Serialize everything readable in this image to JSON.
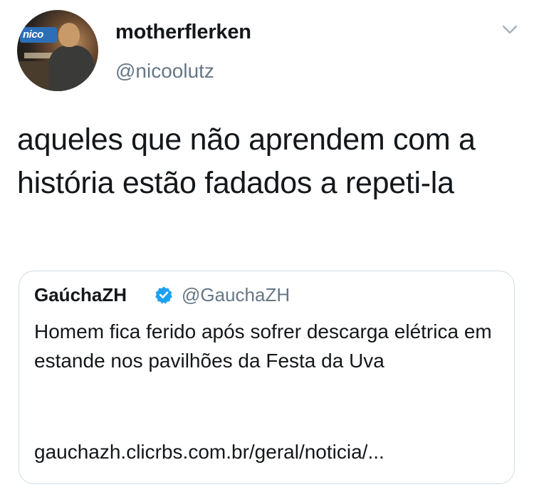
{
  "tweet": {
    "author": {
      "display_name": "motherflerken",
      "handle": "@nicoolutz",
      "avatar_sign_text": "nico"
    },
    "menu_icon": "chevron-down-icon",
    "text": "aqueles que não aprendem com a história estão fadados a repeti-la",
    "quoted_tweet": {
      "display_name": "GaúchaZH",
      "verified_icon": "verified-badge-icon",
      "handle": "@GauchaZH",
      "text": "Homem fica ferido após sofrer descarga elétrica em estande nos pavilhões da Festa da Uva",
      "link": "gauchazh.clicrbs.com.br/geral/noticia/..."
    }
  },
  "colors": {
    "text_primary": "#14171a",
    "text_secondary": "#657786",
    "verified_blue": "#1da1f2",
    "border": "#d3dce3"
  }
}
